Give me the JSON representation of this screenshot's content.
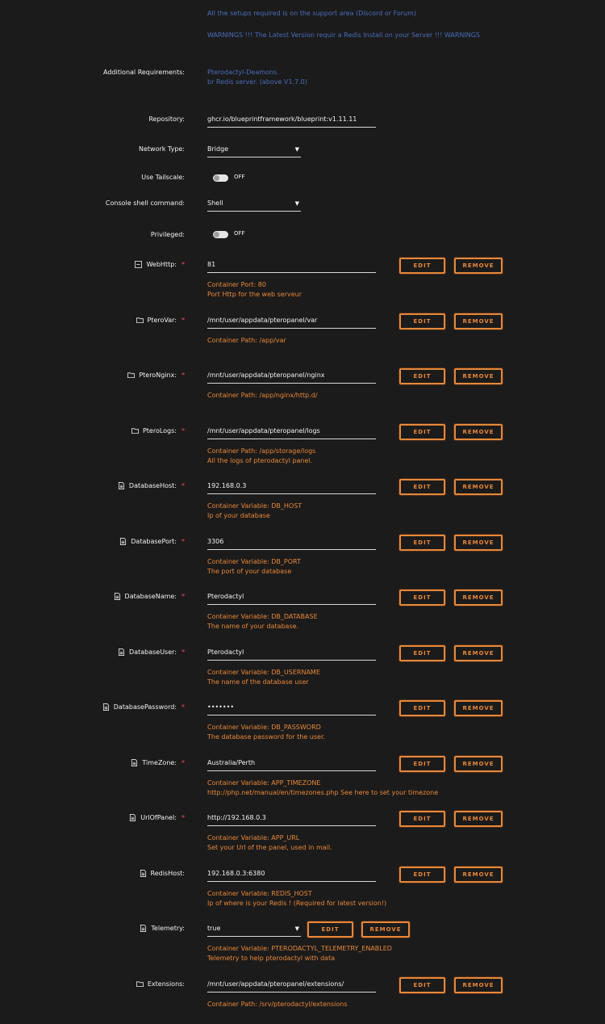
{
  "info": {
    "support": "All the setups required is on the support area (Discord or Forum)",
    "warning": "WARNINGS !!! The Latest Version requir a Redis Install on your Server !!! WARNINGS"
  },
  "additional": {
    "label": "Additional Requirements:",
    "line1": "Pterodactyl-Deamons.",
    "line2": "br Redis server. (above V1.7.0)"
  },
  "repository": {
    "label": "Repository:",
    "value": "ghcr.io/blueprintframework/blueprint:v1.11.11"
  },
  "network": {
    "label": "Network Type:",
    "value": "Bridge"
  },
  "tailscale": {
    "label": "Use Tailscale:",
    "state": "OFF"
  },
  "console": {
    "label": "Console shell command:",
    "value": "Shell"
  },
  "privileged": {
    "label": "Privileged:",
    "state": "OFF"
  },
  "buttons": {
    "edit": "EDIT",
    "remove": "REMOVE"
  },
  "required_mark": "*",
  "configs": [
    {
      "label": "WebHttp:",
      "icon": "network-icon",
      "required": true,
      "value": "81",
      "desc1": "Container Port: 80",
      "desc2": "Port Http for the web serveur"
    },
    {
      "label": "PteroVar:",
      "icon": "folder-icon",
      "required": true,
      "value": "/mnt/user/appdata/pteropanel/var",
      "desc1": "Container Path: /app/var",
      "desc2": ""
    },
    {
      "label": "PteroNginx:",
      "icon": "folder-icon",
      "required": true,
      "value": "/mnt/user/appdata/pteropanel/nginx",
      "desc1": "Container Path: /app/nginx/http.d/",
      "desc2": ""
    },
    {
      "label": "PteroLogs:",
      "icon": "folder-icon",
      "required": true,
      "value": "/mnt/user/appdata/pteropanel/logs",
      "desc1": "Container Path: /app/storage/logs",
      "desc2": "All the logs of pterodactyl panel."
    },
    {
      "label": "DatabaseHost:",
      "icon": "document-icon",
      "required": true,
      "value": "192.168.0.3",
      "desc1": "Container Variable: DB_HOST",
      "desc2": "Ip of your database"
    },
    {
      "label": "DatabasePort:",
      "icon": "document-icon",
      "required": true,
      "value": "3306",
      "desc1": "Container Variable: DB_PORT",
      "desc2": "The port of your database"
    },
    {
      "label": "DatabaseName:",
      "icon": "document-icon",
      "required": true,
      "value": "Pterodactyl",
      "desc1": "Container Variable: DB_DATABASE",
      "desc2": "The name of your database."
    },
    {
      "label": "DatabaseUser:",
      "icon": "document-icon",
      "required": true,
      "value": "Pterodactyl",
      "desc1": "Container Variable: DB_USERNAME",
      "desc2": "The name of the database user"
    },
    {
      "label": "DatabasePassword:",
      "icon": "document-icon",
      "required": true,
      "value": "•••••••",
      "desc1": "Container Variable: DB_PASSWORD",
      "desc2": "The database password for the user."
    },
    {
      "label": "TimeZone:",
      "icon": "document-icon",
      "required": true,
      "value": "Australia/Perth",
      "desc1": "Container Variable: APP_TIMEZONE",
      "desc2": "http://php.net/manual/en/timezones.php See here to set your timezone"
    },
    {
      "label": "UrlOfPanel:",
      "icon": "document-icon",
      "required": true,
      "value": "http://192.168.0.3",
      "desc1": "Container Variable: APP_URL",
      "desc2": "Set your Url of the panel, used in mail."
    },
    {
      "label": "RedisHost:",
      "icon": "document-icon",
      "required": false,
      "value": "192.168.0.3:6380",
      "desc1": "Container Variable: REDIS_HOST",
      "desc2": "Ip of where is your Redis ! (Required for latest version!)"
    },
    {
      "label": "Telemetry:",
      "icon": "document-icon",
      "required": false,
      "value": "true",
      "desc1": "Container Variable: PTERODACTYL_TELEMETRY_ENABLED",
      "desc2": "Telemetry to help pterodactyl with data"
    },
    {
      "label": "Extensions:",
      "icon": "folder-icon",
      "required": false,
      "value": "/mnt/user/appdata/pteropanel/extensions/",
      "desc1": "Container Path: /srv/pterodactyl/extensions",
      "desc2": ""
    }
  ]
}
